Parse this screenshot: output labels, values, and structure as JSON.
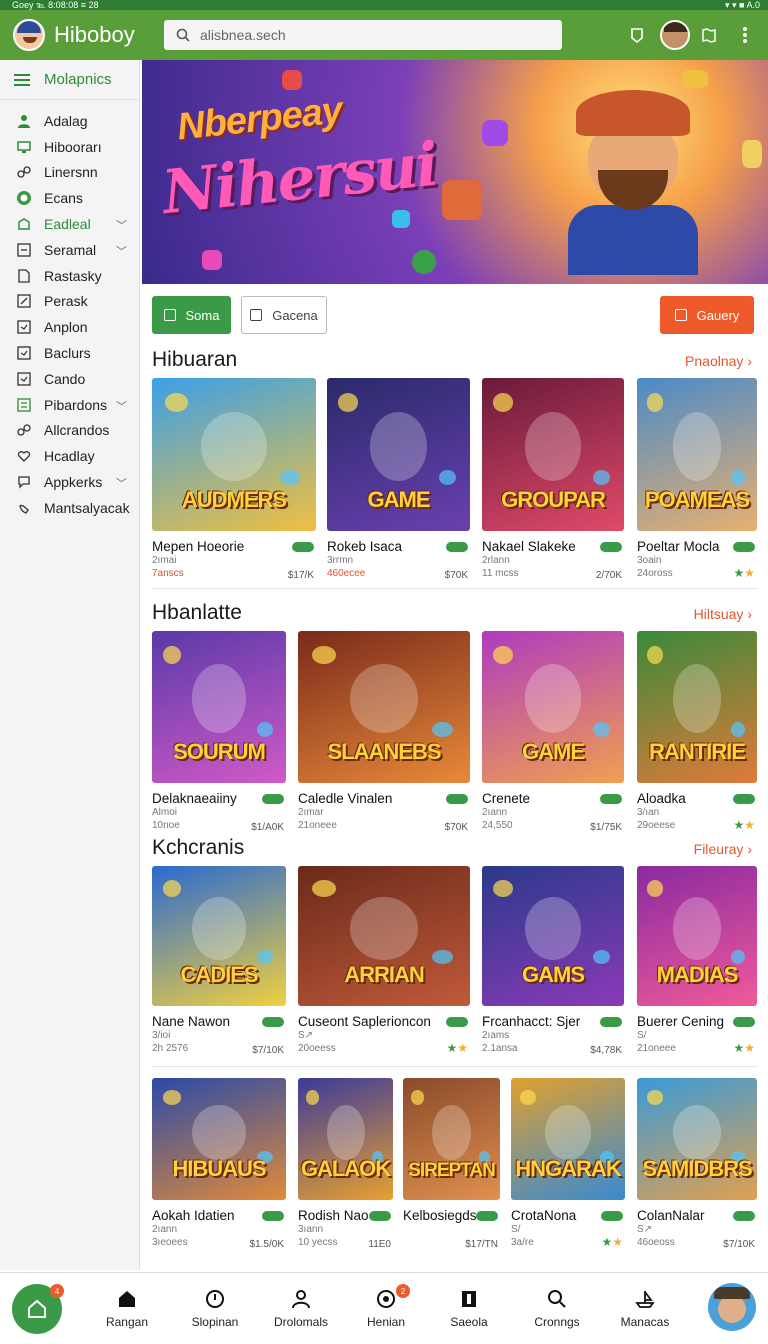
{
  "status": {
    "left": "Goey ℡ 8:08:08 ≡ 28",
    "right": "▾ ▾ ■ A.0"
  },
  "app": {
    "title": "Hiboboy",
    "search_value": "alisbnea.sech"
  },
  "sidebar": {
    "header": "Molapnics",
    "items": [
      {
        "label": "Adalag",
        "icon": "person-icon"
      },
      {
        "label": "Hiboorarı",
        "icon": "monitor-icon"
      },
      {
        "label": "Linersnn",
        "icon": "link-icon"
      },
      {
        "label": "Ecans",
        "icon": "circle-icon"
      },
      {
        "label": "Eadleal",
        "icon": "gamepad-icon",
        "expand": true,
        "active": true
      },
      {
        "label": "Seramal",
        "icon": "tag-icon",
        "expand": true
      },
      {
        "label": "Rastasky",
        "icon": "document-icon"
      },
      {
        "label": "Perask",
        "icon": "edit-icon"
      },
      {
        "label": "Anplon",
        "icon": "square-icon"
      },
      {
        "label": "Baclurs",
        "icon": "square-icon"
      },
      {
        "label": "Cando",
        "icon": "square-icon"
      },
      {
        "label": "Pibardons",
        "icon": "list-icon",
        "expand": true
      },
      {
        "label": "Allcrandos",
        "icon": "link-icon"
      },
      {
        "label": "Hcadlay",
        "icon": "heart-icon"
      },
      {
        "label": "Appkerks",
        "icon": "chat-icon",
        "expand": true
      },
      {
        "label": "Mantsalyacak",
        "icon": "hand-icon"
      }
    ]
  },
  "banner": {
    "line1": "Nberpeay",
    "line2": "Nihersui"
  },
  "filters": {
    "green": "Soma",
    "white": "Gacena",
    "orange": "Gauery"
  },
  "sections": [
    {
      "title": "Hibuaran",
      "link": "Pnaolnay"
    },
    {
      "title": "Hbanlatte",
      "link": "Hiltsuay"
    },
    {
      "title": "Kchcranis",
      "link": "Fileuray"
    }
  ],
  "cards": {
    "s1": [
      {
        "name": "Mepen Hoeorie",
        "sub": "2ımai",
        "meta": "7anscs",
        "price": "$17/K",
        "art": "AUDMERS",
        "c1": "#3aa0e8",
        "c2": "#f0c040"
      },
      {
        "name": "Rokeb Isaca",
        "sub": "3rrmn",
        "meta": "460ecee",
        "price": "$70K",
        "art": "GAME",
        "c1": "#2a2a6a",
        "c2": "#6a40b0"
      },
      {
        "name": "Nakael Slakeke",
        "sub": "2rlann",
        "meta": "11 mcss",
        "price": "2/70K",
        "art": "GROUPAR",
        "c1": "#6a1a3a",
        "c2": "#e04a6a"
      },
      {
        "name": "Poeltar Mocla",
        "sub": "3oain",
        "meta": "24oross",
        "price": "",
        "art": "POAMEAS",
        "c1": "#4a8ac8",
        "c2": "#e8b070"
      }
    ],
    "s2": [
      {
        "name": "Delaknaeaiiny",
        "sub": "Almoi",
        "meta": "10noe",
        "price": "$1/A0K",
        "art": "SOURUM",
        "c1": "#5a3aa8",
        "c2": "#d05ac8"
      },
      {
        "name": "Caledle Vinalen",
        "sub": "2ımar",
        "meta": "21oneee",
        "price": "$70K",
        "art": "SLAANEBS",
        "c1": "#7a2a1a",
        "c2": "#e88a3a"
      },
      {
        "name": "Crenete",
        "sub": "2ıann",
        "meta": "24,550",
        "price": "$1/75K",
        "art": "GAME",
        "c1": "#b03ac0",
        "c2": "#f0a050"
      },
      {
        "name": "Aloadka",
        "sub": "3/ıan",
        "meta": "29oeese",
        "price": "",
        "art": "RANTIRIE",
        "c1": "#3a8a3a",
        "c2": "#e07a3a"
      }
    ],
    "s3": [
      {
        "name": "Nane Nawon",
        "sub": "3/ioi",
        "meta": "2h 2576",
        "price": "$7/10K",
        "art": "CADIES",
        "c1": "#2a6ad0",
        "c2": "#f0d040"
      },
      {
        "name": "Cuseont Saplerioncon",
        "sub": "S↗",
        "meta": "20oeess",
        "price": "",
        "art": "ARRIAN",
        "c1": "#6a2a1a",
        "c2": "#c05a3a"
      },
      {
        "name": "Frcanhacct: Sjer",
        "sub": "2ıams",
        "meta": "2.1ansa",
        "price": "$4,78K",
        "art": "GAMS",
        "c1": "#2a3a8a",
        "c2": "#8a3ab8"
      },
      {
        "name": "Buerer Cening",
        "sub": "S/",
        "meta": "21oneee",
        "price": "",
        "art": "MADIAS",
        "c1": "#8a2aa0",
        "c2": "#f05a9a"
      }
    ],
    "s4": [
      {
        "name": "Aokah Idatien",
        "sub": "2ıann",
        "meta": "3ıeoees",
        "price": "$1.5/0K",
        "art": "HIBUAUS",
        "c1": "#2a4aa8",
        "c2": "#e08a3a"
      },
      {
        "name": "Rodish Nao",
        "sub": "3ıann",
        "meta": "10 yecss",
        "price": "11E0",
        "art": "GALAOK",
        "c1": "#3a3a9a",
        "c2": "#e8a030"
      },
      {
        "name": "Kelbosiegds",
        "sub": "",
        "meta": "",
        "price": "$17/TN",
        "art": "SIREPTAN",
        "c1": "#8a4a2a",
        "c2": "#e09050"
      },
      {
        "name": "CrotaNona",
        "sub": "S/",
        "meta": "3a/re",
        "price": "",
        "art": "HNGARAK",
        "c1": "#e0a030",
        "c2": "#3a8ad0"
      },
      {
        "name": "ColanNalar",
        "sub": "S↗",
        "meta": "46oeoss",
        "price": "$7/10K",
        "art": "SAMIDBRS",
        "c1": "#3a9ad8",
        "c2": "#e0a050"
      }
    ]
  },
  "bottom_nav": [
    {
      "label": "Rangan",
      "icon": "home-icon"
    },
    {
      "label": "Slopinan",
      "icon": "clock-icon"
    },
    {
      "label": "Drolomals",
      "icon": "person-icon"
    },
    {
      "label": "Henian",
      "icon": "target-icon"
    },
    {
      "label": "Saeola",
      "icon": "bookmark-icon"
    },
    {
      "label": "Cronngs",
      "icon": "search-icon"
    },
    {
      "label": "Manacas",
      "icon": "ship-icon"
    }
  ],
  "badges": {
    "home": "4",
    "henian": "2"
  },
  "colors": {
    "green": "#5a9e3a",
    "accent": "#e4572e",
    "chip_green": "#3a9a48",
    "chip_orange": "#ee5a2a"
  }
}
